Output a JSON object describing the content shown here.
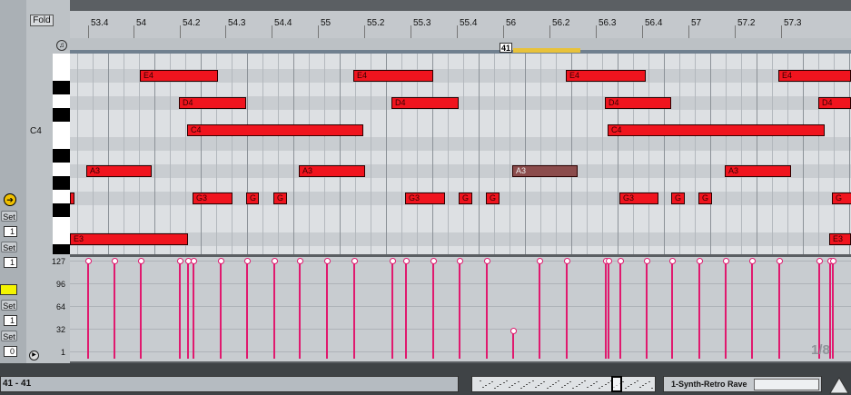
{
  "toolbar": {
    "fold_label": "Fold"
  },
  "ruler": {
    "ticks": [
      "53.4",
      "54",
      "54.2",
      "54.3",
      "54.4",
      "55",
      "55.2",
      "55.3",
      "55.4",
      "56",
      "56.2",
      "56.3",
      "56.4",
      "57",
      "57.2",
      "57.3"
    ]
  },
  "loop": {
    "marker_label": "41"
  },
  "keyboard": {
    "c4_label": "C4"
  },
  "notes": [
    {
      "pitch": "E4",
      "row": 1,
      "start": 0.09,
      "end": 0.19
    },
    {
      "pitch": "E4",
      "row": 1,
      "start": 0.363,
      "end": 0.465
    },
    {
      "pitch": "E4",
      "row": 1,
      "start": 0.635,
      "end": 0.737
    },
    {
      "pitch": "E4",
      "row": 1,
      "start": 0.907,
      "end": 1.0
    },
    {
      "pitch": "D4",
      "row": 3,
      "start": 0.14,
      "end": 0.226
    },
    {
      "pitch": "D4",
      "row": 3,
      "start": 0.412,
      "end": 0.498
    },
    {
      "pitch": "D4",
      "row": 3,
      "start": 0.685,
      "end": 0.77
    },
    {
      "pitch": "D4",
      "row": 3,
      "start": 0.958,
      "end": 1.0
    },
    {
      "pitch": "C4",
      "row": 5,
      "start": 0.15,
      "end": 0.375
    },
    {
      "pitch": "C4",
      "row": 5,
      "start": 0.688,
      "end": 0.966
    },
    {
      "pitch": "A3",
      "row": 8,
      "start": 0.021,
      "end": 0.105
    },
    {
      "pitch": "A3",
      "row": 8,
      "start": 0.293,
      "end": 0.378
    },
    {
      "pitch": "A3",
      "row": 8,
      "start": 0.566,
      "end": 0.65,
      "selected": true
    },
    {
      "pitch": "A3",
      "row": 8,
      "start": 0.838,
      "end": 0.923
    },
    {
      "pitch": "",
      "row": 10,
      "start": 0.0,
      "end": 0.003
    },
    {
      "pitch": "G3",
      "row": 10,
      "start": 0.157,
      "end": 0.208
    },
    {
      "pitch": "G",
      "row": 10,
      "start": 0.226,
      "end": 0.242
    },
    {
      "pitch": "G",
      "row": 10,
      "start": 0.26,
      "end": 0.277
    },
    {
      "pitch": "G3",
      "row": 10,
      "start": 0.429,
      "end": 0.48
    },
    {
      "pitch": "G",
      "row": 10,
      "start": 0.498,
      "end": 0.515
    },
    {
      "pitch": "G",
      "row": 10,
      "start": 0.532,
      "end": 0.55
    },
    {
      "pitch": "G3",
      "row": 10,
      "start": 0.703,
      "end": 0.753
    },
    {
      "pitch": "G",
      "row": 10,
      "start": 0.77,
      "end": 0.788
    },
    {
      "pitch": "G",
      "row": 10,
      "start": 0.805,
      "end": 0.822
    },
    {
      "pitch": "G",
      "row": 10,
      "start": 0.975,
      "end": 1.0
    },
    {
      "pitch": "E3",
      "row": 13,
      "start": 0.0,
      "end": 0.151
    },
    {
      "pitch": "E3",
      "row": 13,
      "start": 0.972,
      "end": 1.0
    }
  ],
  "velocity": {
    "labels": [
      "127",
      "96",
      "64",
      "32",
      "1"
    ],
    "events": [
      {
        "x": 0.022,
        "v": 127
      },
      {
        "x": 0.056,
        "v": 127
      },
      {
        "x": 0.09,
        "v": 127
      },
      {
        "x": 0.14,
        "v": 127
      },
      {
        "x": 0.15,
        "v": 127
      },
      {
        "x": 0.157,
        "v": 127
      },
      {
        "x": 0.192,
        "v": 127
      },
      {
        "x": 0.226,
        "v": 127
      },
      {
        "x": 0.26,
        "v": 127
      },
      {
        "x": 0.293,
        "v": 127
      },
      {
        "x": 0.328,
        "v": 127
      },
      {
        "x": 0.363,
        "v": 127
      },
      {
        "x": 0.412,
        "v": 127
      },
      {
        "x": 0.429,
        "v": 127
      },
      {
        "x": 0.464,
        "v": 127
      },
      {
        "x": 0.498,
        "v": 127
      },
      {
        "x": 0.532,
        "v": 127
      },
      {
        "x": 0.566,
        "v": 30
      },
      {
        "x": 0.6,
        "v": 127
      },
      {
        "x": 0.635,
        "v": 127
      },
      {
        "x": 0.685,
        "v": 127
      },
      {
        "x": 0.688,
        "v": 127
      },
      {
        "x": 0.703,
        "v": 127
      },
      {
        "x": 0.737,
        "v": 127
      },
      {
        "x": 0.77,
        "v": 127
      },
      {
        "x": 0.805,
        "v": 127
      },
      {
        "x": 0.838,
        "v": 127
      },
      {
        "x": 0.872,
        "v": 127
      },
      {
        "x": 0.907,
        "v": 127
      },
      {
        "x": 0.958,
        "v": 127
      },
      {
        "x": 0.972,
        "v": 127
      },
      {
        "x": 0.975,
        "v": 127
      }
    ]
  },
  "left_panel": {
    "set1": "Set",
    "val1": "1",
    "set2": "Set",
    "val2": "1",
    "set3": "Set",
    "val3": "1",
    "set4": "Set",
    "val4": "0"
  },
  "pager": "1/8",
  "status": {
    "position": "41 - 41"
  },
  "track": {
    "name": "1-Synth-Retro Rave"
  },
  "colors": {
    "note": "#f0141e",
    "velocity": "#e0196e",
    "loop": "#e8c23a"
  }
}
